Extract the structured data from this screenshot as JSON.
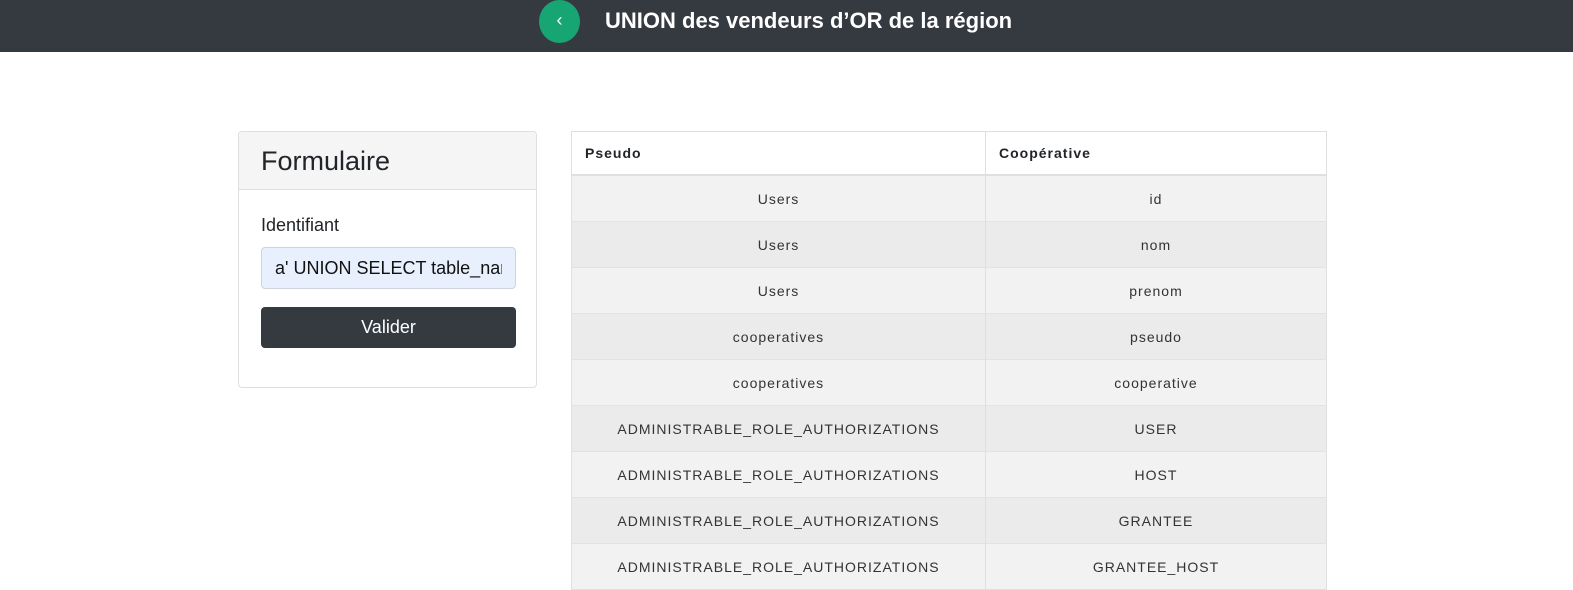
{
  "header": {
    "back_label": "‹",
    "title": "UNION des vendeurs d’OR de la région",
    "accent_color": "#17a673",
    "bar_color": "#343a40"
  },
  "form": {
    "title": "Formulaire",
    "identifier_label": "Identifiant",
    "identifier_value": "a' UNION SELECT table_nar",
    "submit_label": "Valider"
  },
  "table": {
    "columns": [
      "Pseudo",
      "Coopérative"
    ],
    "rows": [
      [
        "Users",
        "id"
      ],
      [
        "Users",
        "nom"
      ],
      [
        "Users",
        "prenom"
      ],
      [
        "cooperatives",
        "pseudo"
      ],
      [
        "cooperatives",
        "cooperative"
      ],
      [
        "ADMINISTRABLE_ROLE_AUTHORIZATIONS",
        "USER"
      ],
      [
        "ADMINISTRABLE_ROLE_AUTHORIZATIONS",
        "HOST"
      ],
      [
        "ADMINISTRABLE_ROLE_AUTHORIZATIONS",
        "GRANTEE"
      ],
      [
        "ADMINISTRABLE_ROLE_AUTHORIZATIONS",
        "GRANTEE_HOST"
      ]
    ]
  }
}
